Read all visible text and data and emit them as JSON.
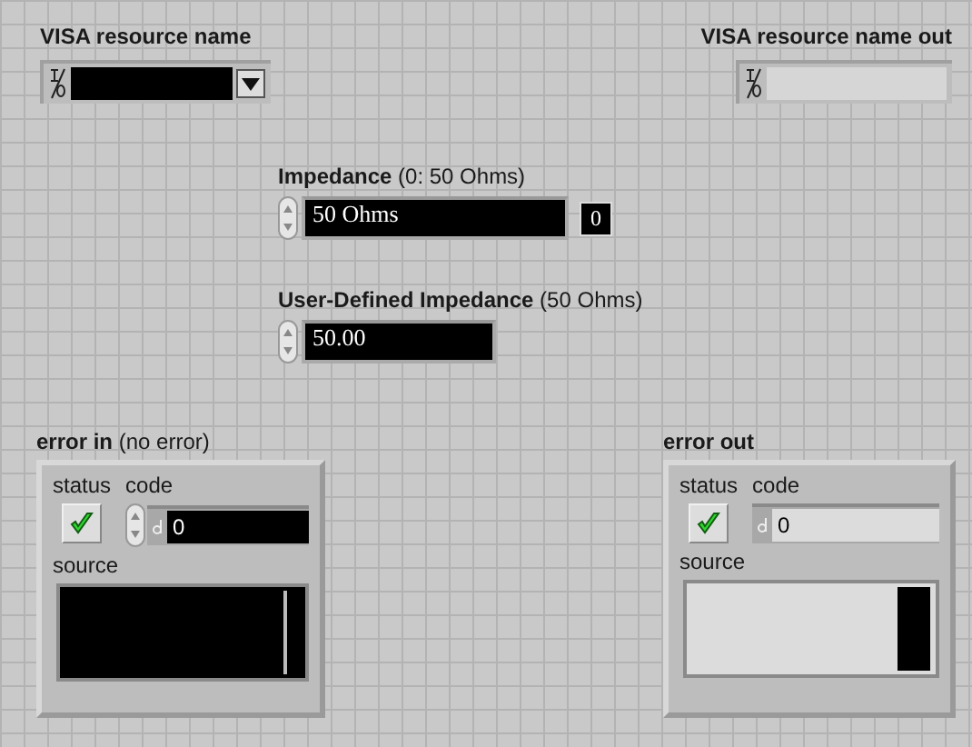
{
  "visa_in": {
    "label": "VISA resource name",
    "kind": "control"
  },
  "visa_out": {
    "label": "VISA resource name out",
    "kind": "indicator"
  },
  "impedance": {
    "label": "**Impedance** (0: 50 Ohms)",
    "value": "50 Ohms",
    "index": "0"
  },
  "user_impedance": {
    "label": "**User-Defined Impedance** (50 Ohms)",
    "value": "50.00"
  },
  "error_in": {
    "label": "**error in** (no error)",
    "kind": "control",
    "status_label": "status",
    "status": true,
    "code_label": "code",
    "code": "0",
    "source_label": "source"
  },
  "error_out": {
    "label": "error out",
    "kind": "indicator",
    "status_label": "status",
    "status": true,
    "code_label": "code",
    "code": "0",
    "source_label": "source"
  }
}
